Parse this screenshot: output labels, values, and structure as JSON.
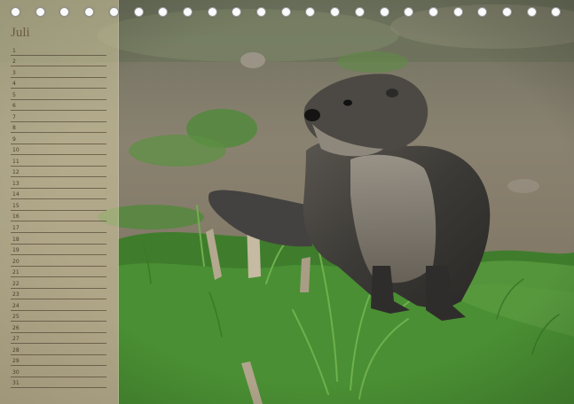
{
  "calendar": {
    "month": "Juli",
    "days": [
      "1",
      "2",
      "3",
      "4",
      "5",
      "6",
      "7",
      "8",
      "9",
      "10",
      "11",
      "12",
      "13",
      "14",
      "15",
      "16",
      "17",
      "18",
      "19",
      "20",
      "21",
      "22",
      "23",
      "24",
      "25",
      "26",
      "27",
      "28",
      "29",
      "30",
      "31"
    ]
  },
  "photo": {
    "subject": "otter-on-grass"
  },
  "colors": {
    "panel": "#d0c8a0",
    "month_text": "#6e5a3c",
    "lines": "#463728",
    "grass": "#3f7d2c",
    "soil": "#8a7e6c"
  }
}
